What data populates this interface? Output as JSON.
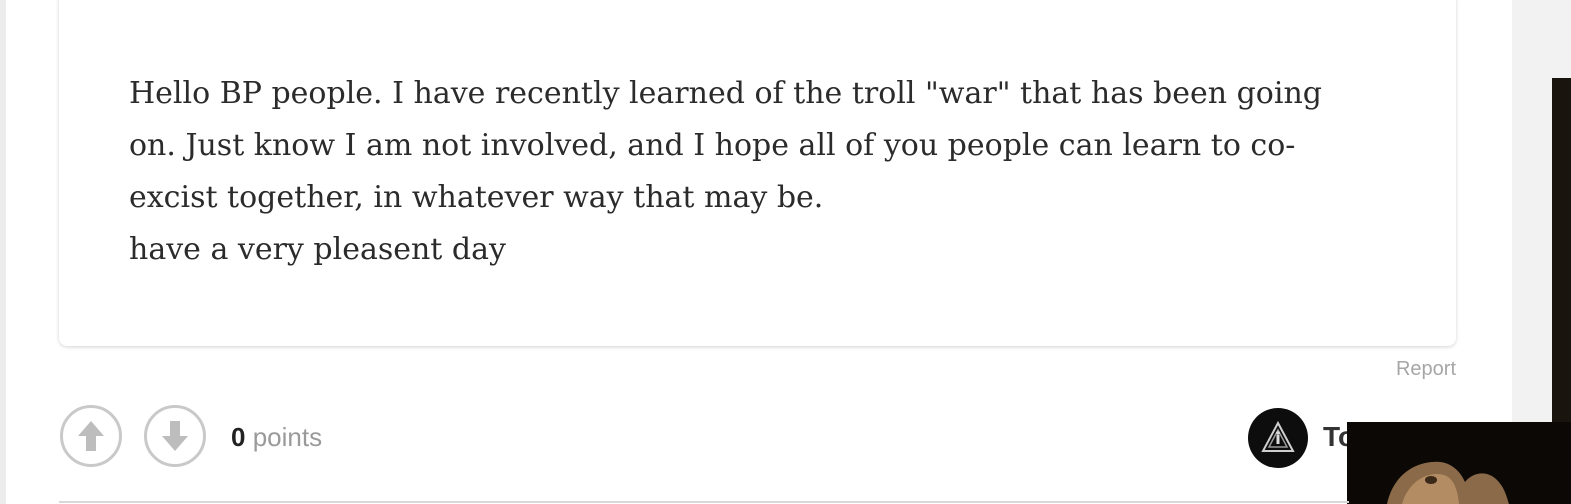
{
  "post": {
    "body_lines": [
      "Hello BP people. I have recently learned of the troll \"war\" that has been going",
      "on. Just know I am not involved, and I hope all of you people can learn to co-",
      "excist together, in whatever way that may be.",
      "have a very pleasent day"
    ],
    "report_label": "Report"
  },
  "votes": {
    "upvote_icon": "arrow-up-icon",
    "downvote_icon": "arrow-down-icon",
    "count": "0",
    "unit": "points"
  },
  "author": {
    "name_visible": "To",
    "avatar_icon": "triangle-emblem-icon"
  },
  "colors": {
    "page_background": "#ffffff",
    "card_background": "#ffffff",
    "body_text": "#2b2b2b",
    "muted_text": "#a6a6a6",
    "vote_border": "#c9c9c9",
    "avatar_background": "#0d0d0d"
  }
}
